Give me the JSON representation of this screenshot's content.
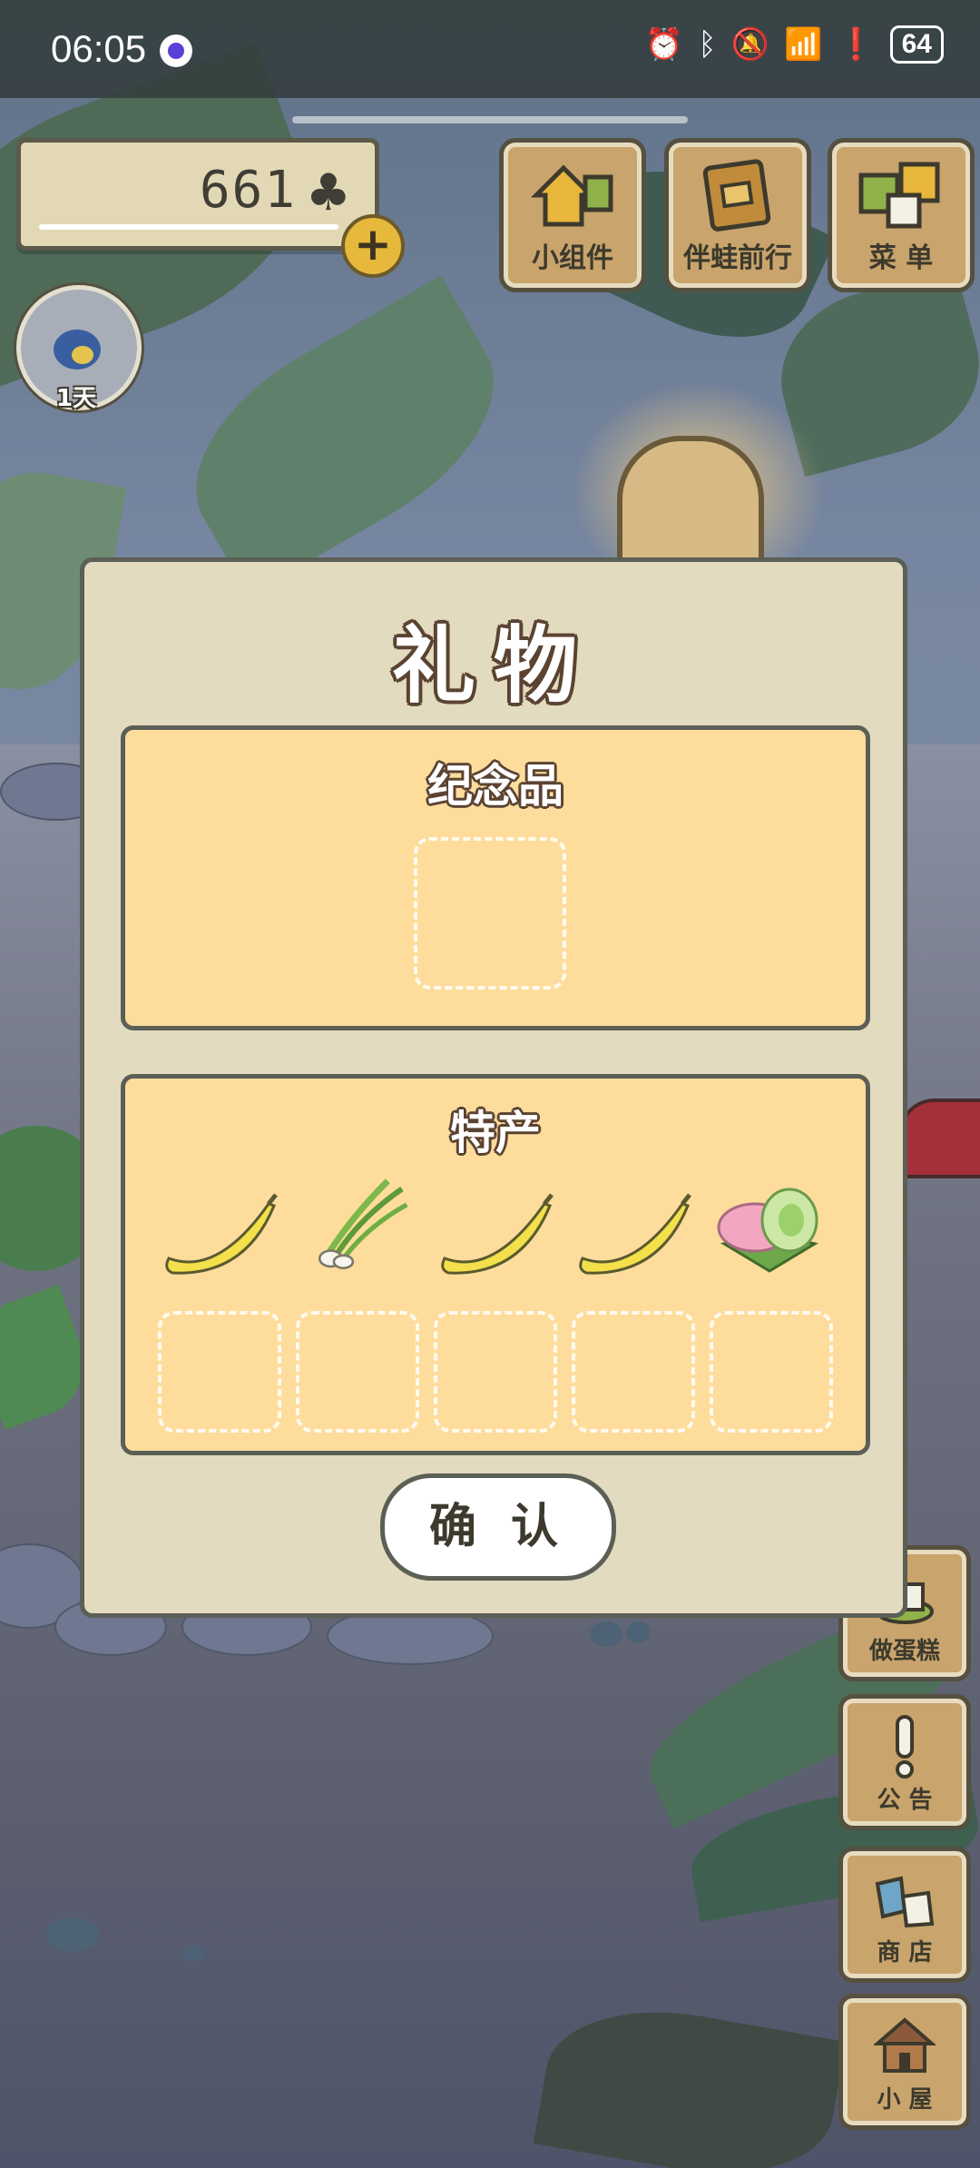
{
  "status_bar": {
    "time": "06:05",
    "battery": "64"
  },
  "currency": {
    "amount": "661",
    "icon": "clover-icon"
  },
  "top_buttons": [
    {
      "label": "小组件",
      "icon": "widget-icon"
    },
    {
      "label": "伴蛙前行",
      "icon": "journal-icon"
    },
    {
      "label": "菜 单",
      "icon": "menu-icon"
    }
  ],
  "frog_status": {
    "days": "1天"
  },
  "side_buttons": [
    {
      "label": "做蛋糕",
      "icon": "cake-icon"
    },
    {
      "label": "公 告",
      "icon": "exclamation-icon"
    },
    {
      "label": "商 店",
      "icon": "shop-bag-icon"
    },
    {
      "label": "小 屋",
      "icon": "house-icon"
    }
  ],
  "dialog": {
    "title": "礼物",
    "souvenir_section": {
      "title": "纪念品"
    },
    "specialty_section": {
      "title": "特产",
      "items": [
        "banana-icon",
        "green-onion-icon",
        "banana-icon",
        "banana-icon",
        "mochi-icon"
      ]
    },
    "confirm_label": "确 认"
  },
  "colors": {
    "panel_fill": "#fedd9c",
    "dialog_fill": "#e3dbbf",
    "border": "#5b5f55",
    "wood": "#c9a46c"
  }
}
